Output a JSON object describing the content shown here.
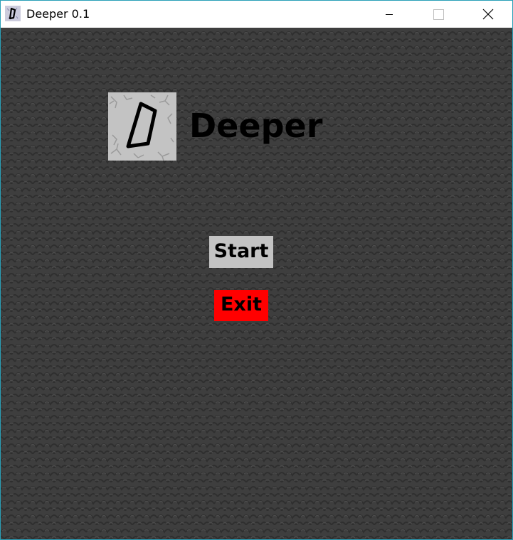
{
  "window": {
    "title": "Deeper 0.1",
    "icon": "deeper-app-icon",
    "controls": {
      "minimize_icon": "minimize-icon",
      "maximize_icon": "maximize-icon",
      "close_icon": "close-icon"
    }
  },
  "game": {
    "title": "Deeper",
    "logo_icon": "deeper-logo-icon",
    "menu": {
      "start_label": "Start",
      "exit_label": "Exit"
    },
    "colors": {
      "background": "#3e3e3e",
      "start_button": "#c3c3c3",
      "exit_button": "#ff0000",
      "logo_tile": "#c3c3c3"
    }
  }
}
